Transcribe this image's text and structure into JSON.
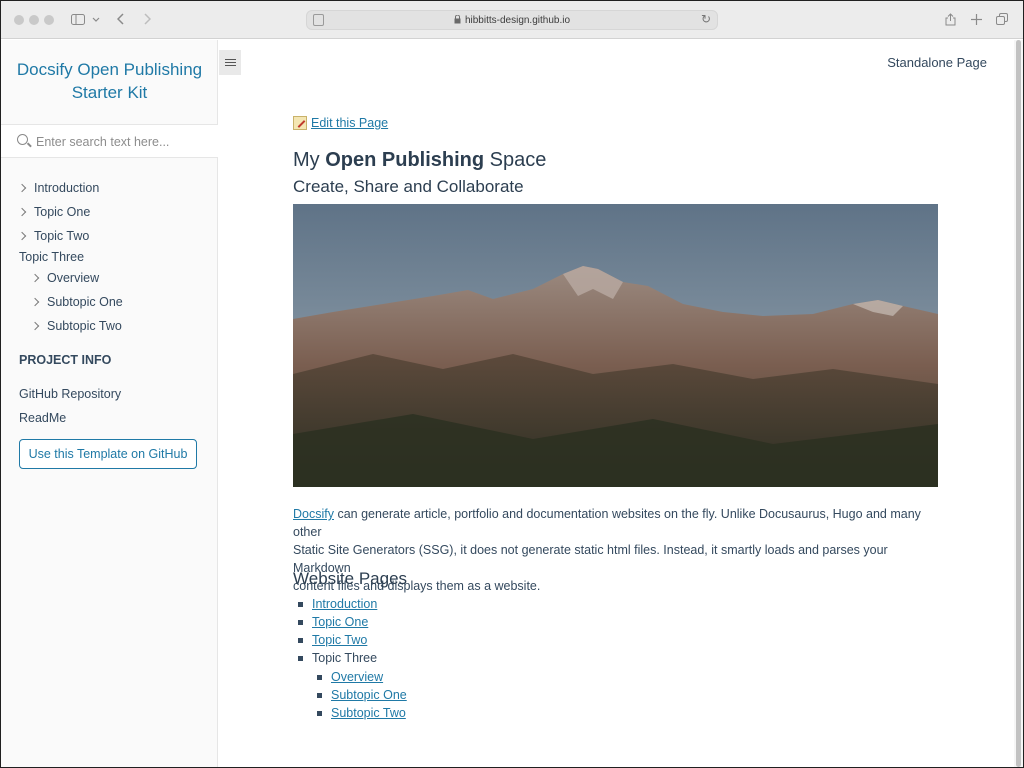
{
  "browser": {
    "url": "hibbitts-design.github.io"
  },
  "sidebar": {
    "app_name_line1": "Docsify Open Publishing",
    "app_name_line2": "Starter Kit",
    "search_placeholder": "Enter search text here...",
    "nav": [
      {
        "label": "Introduction"
      },
      {
        "label": "Topic One"
      },
      {
        "label": "Topic Two"
      },
      {
        "label": "Topic Three"
      },
      {
        "label": "Overview"
      },
      {
        "label": "Subtopic One"
      },
      {
        "label": "Subtopic Two"
      }
    ],
    "project_info_title": "PROJECT INFO",
    "project_links": [
      {
        "label": "GitHub Repository"
      },
      {
        "label": "ReadMe"
      }
    ],
    "template_button": "Use this Template on GitHub"
  },
  "main": {
    "standalone_link": "Standalone Page",
    "edit_link": "Edit this Page",
    "title_prefix": "My ",
    "title_bold": "Open Publishing",
    "title_suffix": " Space",
    "subtitle": "Create, Share and Collaborate",
    "para_link": "Docsify",
    "para_line1": " can generate article, portfolio and documentation websites on the fly. Unlike Docusaurus, Hugo and many other",
    "para_line2": "Static Site Generators (SSG), it does not generate static html files. Instead, it smartly loads and parses your Markdown",
    "para_line3": "content files and displays them as a website.",
    "pages_heading": "Website Pages",
    "pages": [
      {
        "label": "Introduction"
      },
      {
        "label": "Topic One"
      },
      {
        "label": "Topic Two"
      },
      {
        "label": "Topic Three"
      },
      {
        "label": "Overview"
      },
      {
        "label": "Subtopic One"
      },
      {
        "label": "Subtopic Two"
      }
    ]
  }
}
